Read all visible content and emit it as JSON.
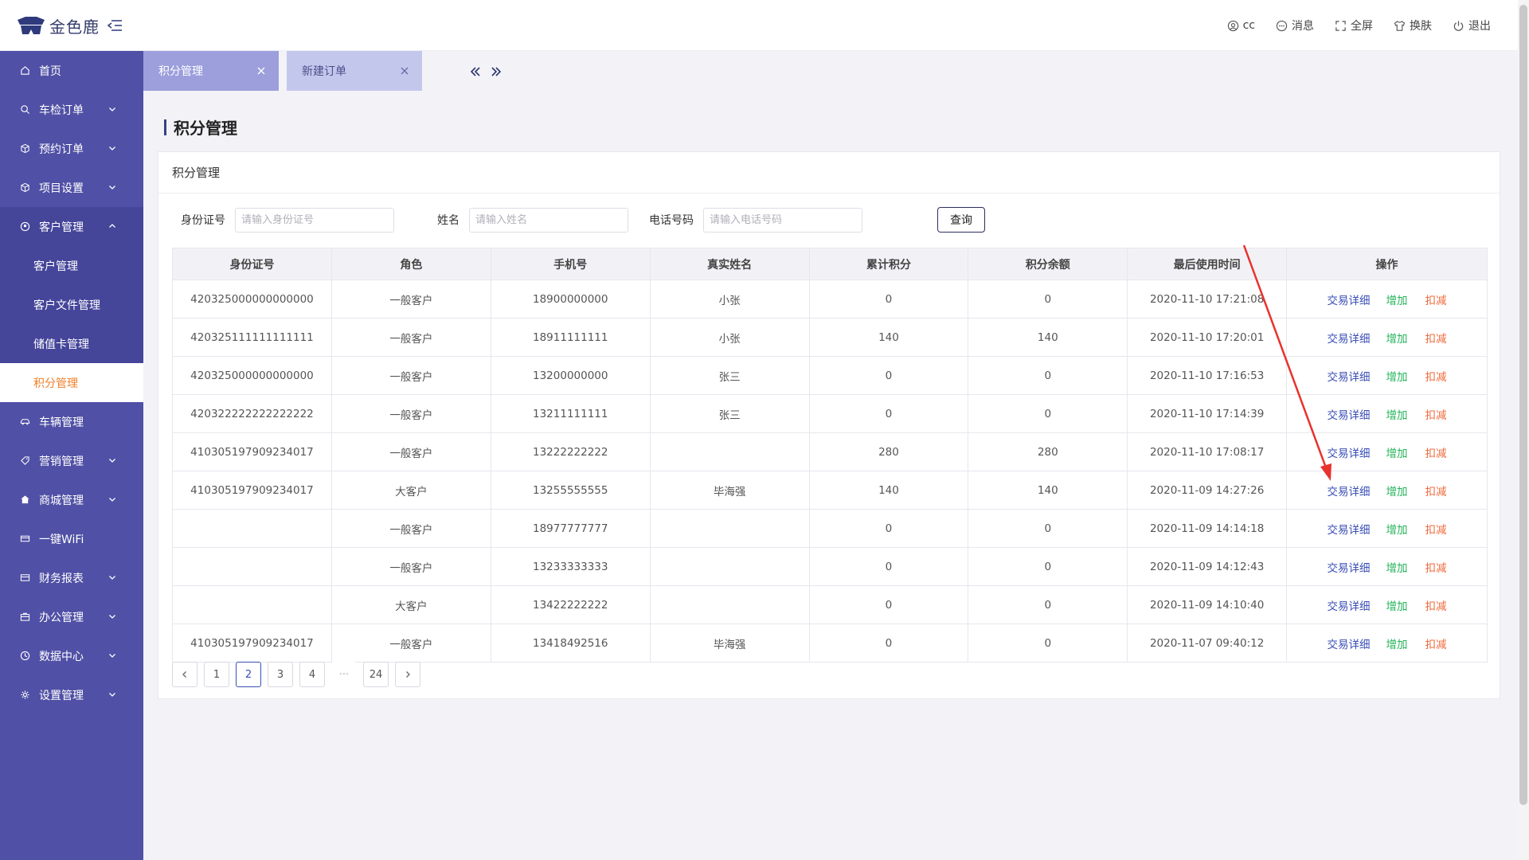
{
  "app": {
    "logo_text": "金色鹿"
  },
  "topbar": {
    "user": "cc",
    "messages": "消息",
    "fullscreen": "全屏",
    "skin": "换肤",
    "logout": "退出"
  },
  "sidebar": {
    "items": [
      {
        "label": "首页"
      },
      {
        "label": "车检订单"
      },
      {
        "label": "预约订单"
      },
      {
        "label": "项目设置"
      },
      {
        "label": "客户管理"
      },
      {
        "label": "车辆管理"
      },
      {
        "label": "营销管理"
      },
      {
        "label": "商城管理"
      },
      {
        "label": "一键WiFi"
      },
      {
        "label": "财务报表"
      },
      {
        "label": "办公管理"
      },
      {
        "label": "数据中心"
      },
      {
        "label": "设置管理"
      }
    ],
    "sub_items": [
      {
        "label": "客户管理"
      },
      {
        "label": "客户文件管理"
      },
      {
        "label": "储值卡管理"
      },
      {
        "label": "积分管理"
      }
    ]
  },
  "tabs": [
    {
      "label": "积分管理"
    },
    {
      "label": "新建订单"
    }
  ],
  "page": {
    "title": "积分管理",
    "card_title": "积分管理"
  },
  "filters": {
    "id_label": "身份证号",
    "id_placeholder": "请输入身份证号",
    "name_label": "姓名",
    "name_placeholder": "请输入姓名",
    "phone_label": "电话号码",
    "phone_placeholder": "请输入电话号码",
    "query_label": "查询"
  },
  "table": {
    "headers": [
      "身份证号",
      "角色",
      "手机号",
      "真实姓名",
      "累计积分",
      "积分余额",
      "最后使用时间",
      "操作"
    ],
    "rows": [
      {
        "id": "420325000000000000",
        "role": "一般客户",
        "phone": "18900000000",
        "name": "小张",
        "total": "0",
        "balance": "0",
        "time": "2020-11-10 17:21:08"
      },
      {
        "id": "420325111111111111",
        "role": "一般客户",
        "phone": "18911111111",
        "name": "小张",
        "total": "140",
        "balance": "140",
        "time": "2020-11-10 17:20:01"
      },
      {
        "id": "420325000000000000",
        "role": "一般客户",
        "phone": "13200000000",
        "name": "张三",
        "total": "0",
        "balance": "0",
        "time": "2020-11-10 17:16:53"
      },
      {
        "id": "420322222222222222",
        "role": "一般客户",
        "phone": "13211111111",
        "name": "张三",
        "total": "0",
        "balance": "0",
        "time": "2020-11-10 17:14:39"
      },
      {
        "id": "410305197909234017",
        "role": "一般客户",
        "phone": "13222222222",
        "name": "",
        "total": "280",
        "balance": "280",
        "time": "2020-11-10 17:08:17"
      },
      {
        "id": "410305197909234017",
        "role": "大客户",
        "phone": "13255555555",
        "name": "毕海强",
        "total": "140",
        "balance": "140",
        "time": "2020-11-09 14:27:26"
      },
      {
        "id": "",
        "role": "一般客户",
        "phone": "18977777777",
        "name": "",
        "total": "0",
        "balance": "0",
        "time": "2020-11-09 14:14:18"
      },
      {
        "id": "",
        "role": "一般客户",
        "phone": "13233333333",
        "name": "",
        "total": "0",
        "balance": "0",
        "time": "2020-11-09 14:12:43"
      },
      {
        "id": "",
        "role": "大客户",
        "phone": "13422222222",
        "name": "",
        "total": "0",
        "balance": "0",
        "time": "2020-11-09 14:10:40"
      },
      {
        "id": "410305197909234017",
        "role": "一般客户",
        "phone": "13418492516",
        "name": "毕海强",
        "total": "0",
        "balance": "0",
        "time": "2020-11-07 09:40:12"
      }
    ],
    "actions": {
      "detail": "交易详细",
      "add": "增加",
      "deduct": "扣减"
    }
  },
  "pagination": {
    "pages": [
      "1",
      "2",
      "3",
      "4",
      "···",
      "24"
    ],
    "current": "2"
  },
  "colors": {
    "sidebar": "#5050a6",
    "active_tab": "#9c9fdc",
    "active_sub": "#f0802a",
    "link_detail": "#3a4eb6",
    "link_add": "#23b35a",
    "link_deduct": "#f06a3c",
    "annotation_arrow": "#e8322c"
  },
  "icons": {
    "sidebar": [
      "home-icon",
      "search-icon",
      "box-icon",
      "cube-icon",
      "user-circle-icon",
      "car-icon",
      "tag-icon",
      "shop-icon",
      "wifi-card-icon",
      "report-icon",
      "briefcase-icon",
      "data-center-icon",
      "gear-icon"
    ]
  }
}
